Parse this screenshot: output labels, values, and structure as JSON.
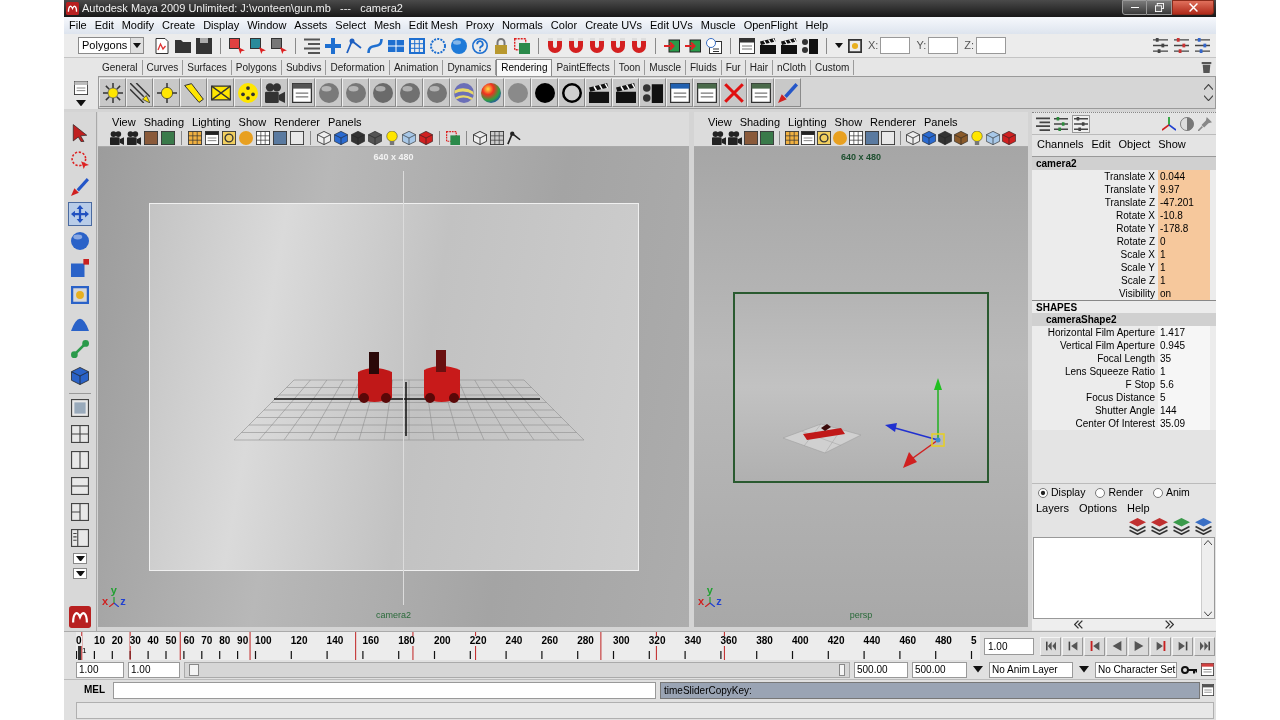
{
  "window": {
    "title": "Autodesk Maya 2009 Unlimited: J:\\vonteen\\gun.mb   ---   camera2"
  },
  "menu_bar": [
    "File",
    "Edit",
    "Modify",
    "Create",
    "Display",
    "Window",
    "Assets",
    "Select",
    "Mesh",
    "Edit Mesh",
    "Proxy",
    "Normals",
    "Color",
    "Create UVs",
    "Edit UVs",
    "Muscle",
    "OpenFlight",
    "Help"
  ],
  "status_line": {
    "menu_set": "Polygons",
    "coordinates": [
      {
        "label": "X:"
      },
      {
        "label": "Y:"
      },
      {
        "label": "Z:"
      }
    ]
  },
  "shelf": {
    "tabs": [
      {
        "label": "General",
        "selected": false
      },
      {
        "label": "Curves",
        "selected": false
      },
      {
        "label": "Surfaces",
        "selected": false
      },
      {
        "label": "Polygons",
        "selected": false
      },
      {
        "label": "Subdivs",
        "selected": false
      },
      {
        "label": "Deformation",
        "selected": false
      },
      {
        "label": "Animation",
        "selected": false
      },
      {
        "label": "Dynamics",
        "selected": false
      },
      {
        "label": "Rendering",
        "selected": true
      },
      {
        "label": "PaintEffects",
        "selected": false
      },
      {
        "label": "Toon",
        "selected": false
      },
      {
        "label": "Muscle",
        "selected": false
      },
      {
        "label": "Fluids",
        "selected": false
      },
      {
        "label": "Fur",
        "selected": false
      },
      {
        "label": "Hair",
        "selected": false
      },
      {
        "label": "nCloth",
        "selected": false
      },
      {
        "label": "Custom",
        "selected": false
      }
    ]
  },
  "toolbox": {
    "tools": [
      {
        "selected": false
      },
      {
        "selected": false
      },
      {
        "selected": false
      },
      {
        "selected": true
      },
      {
        "selected": false
      },
      {
        "selected": false
      },
      {
        "selected": false
      },
      {
        "selected": false
      },
      {
        "selected": false
      },
      {
        "selected": false
      }
    ]
  },
  "viewports": [
    {
      "menu": [
        "View",
        "Shading",
        "Lighting",
        "Show",
        "Renderer",
        "Panels"
      ],
      "resolution": "640 x 480",
      "color": "#f2f2f2",
      "camera": "camera2",
      "axes": [
        {
          "label": "y",
          "color": "#20a030"
        },
        {
          "label": "x",
          "color": "#d02020"
        },
        {
          "label": "z",
          "color": "#2040d0"
        }
      ]
    },
    {
      "menu": [
        "View",
        "Shading",
        "Lighting",
        "Show",
        "Renderer",
        "Panels"
      ],
      "resolution": "640 x 480",
      "color": "#1e5030",
      "camera": "persp",
      "axes": [
        {
          "label": "y",
          "color": "#20a030"
        },
        {
          "label": "x",
          "color": "#d02020"
        },
        {
          "label": "z",
          "color": "#2040d0"
        }
      ]
    }
  ],
  "channel_box": {
    "menu": [
      "Channels",
      "Edit",
      "Object",
      "Show"
    ],
    "object": "camera2",
    "channels": [
      {
        "name": "Translate X",
        "value": "0.044",
        "keyed": true
      },
      {
        "name": "Translate Y",
        "value": "9.97",
        "keyed": true
      },
      {
        "name": "Translate Z",
        "value": "-47.201",
        "keyed": true
      },
      {
        "name": "Rotate X",
        "value": "-10.8",
        "keyed": true
      },
      {
        "name": "Rotate Y",
        "value": "-178.8",
        "keyed": true
      },
      {
        "name": "Rotate Z",
        "value": "0",
        "keyed": true
      },
      {
        "name": "Scale X",
        "value": "1",
        "keyed": true
      },
      {
        "name": "Scale Y",
        "value": "1",
        "keyed": true
      },
      {
        "name": "Scale Z",
        "value": "1",
        "keyed": true
      },
      {
        "name": "Visibility",
        "value": "on",
        "keyed": true
      }
    ],
    "shapes_heading": "SHAPES",
    "shape": "cameraShape2",
    "shape_channels": [
      {
        "name": "Horizontal Film Aperture",
        "value": "1.417",
        "keyed": false
      },
      {
        "name": "Vertical Film Aperture",
        "value": "0.945",
        "keyed": false
      },
      {
        "name": "Focal Length",
        "value": "35",
        "keyed": false
      },
      {
        "name": "Lens Squeeze Ratio",
        "value": "1",
        "keyed": false
      },
      {
        "name": "F Stop",
        "value": "5.6",
        "keyed": false
      },
      {
        "name": "Focus Distance",
        "value": "5",
        "keyed": false
      },
      {
        "name": "Shutter Angle",
        "value": "144",
        "keyed": false
      },
      {
        "name": "Center Of Interest",
        "value": "35.09",
        "keyed": false
      }
    ]
  },
  "layer_editor": {
    "modes": [
      {
        "label": "Display",
        "selected": true
      },
      {
        "label": "Render",
        "selected": false
      },
      {
        "label": "Anim",
        "selected": false
      }
    ],
    "menu": [
      "Layers",
      "Options",
      "Help"
    ]
  },
  "time_slider": {
    "ticks": [
      "0",
      "10",
      "20",
      "30",
      "40",
      "50",
      "60",
      "70",
      "80",
      "90",
      "100",
      "120",
      "140",
      "160",
      "180",
      "200",
      "220",
      "240",
      "260",
      "280",
      "300",
      "320",
      "340",
      "360",
      "380",
      "400",
      "420",
      "440",
      "460",
      "480",
      "5"
    ],
    "level": 0.002,
    "current_marker": "1",
    "current_frame": "1.00"
  },
  "range_slider": {
    "start": "1.00",
    "playback_start": "1.00",
    "playback_end": "500.00",
    "end": "500.00",
    "anim_layer": "No Anim Layer",
    "character_set": "No Character Set"
  },
  "command_line": {
    "language": "MEL",
    "result": "timeSliderCopyKey:"
  }
}
